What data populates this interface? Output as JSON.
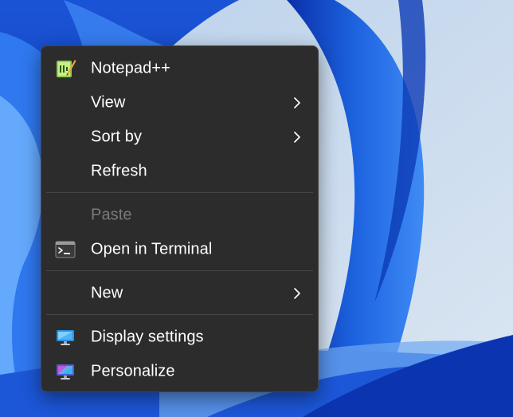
{
  "context_menu": {
    "items": [
      {
        "label": "Notepad++",
        "icon": "notepad-plus-plus-icon"
      },
      {
        "label": "View",
        "submenu": true
      },
      {
        "label": "Sort by",
        "submenu": true
      },
      {
        "label": "Refresh"
      },
      {
        "label": "Paste",
        "disabled": true
      },
      {
        "label": "Open in Terminal",
        "icon": "terminal-icon"
      },
      {
        "label": "New",
        "submenu": true
      },
      {
        "label": "Display settings",
        "icon": "display-settings-icon"
      },
      {
        "label": "Personalize",
        "icon": "personalize-icon"
      }
    ]
  },
  "colors": {
    "menu_background": "#2c2c2c",
    "menu_text": "#ffffff",
    "disabled_text": "#7a7a7a",
    "separator": "#454545",
    "wallpaper_blue": "#1f5fd6",
    "wallpaper_light": "#c9dbee"
  }
}
